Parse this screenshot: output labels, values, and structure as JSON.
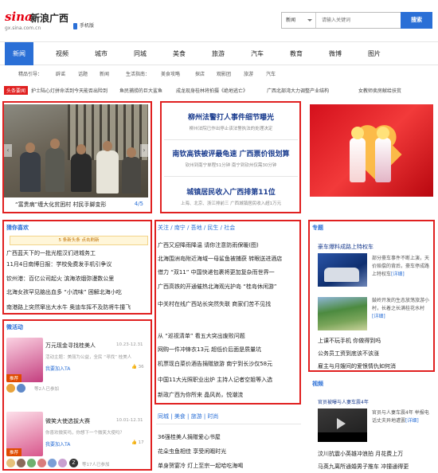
{
  "header": {
    "logo_mark": "sina",
    "logo_text": "新浪广西",
    "domain": "gx.sina.com.cn",
    "mobile": "手机版",
    "search_category": "新闻",
    "search_placeholder": "请输入关键词",
    "search_button": "搜索"
  },
  "nav": [
    "新闻",
    "视频",
    "城市",
    "同城",
    "美食",
    "旅游",
    "汽车",
    "教育",
    "微博",
    "图片"
  ],
  "subnav": {
    "label": "精品引导：",
    "items": [
      "辟谣",
      "话题",
      "新闻",
      "生活指南：",
      "美食攻略",
      "探店",
      "观影团",
      "旅游",
      "汽车"
    ]
  },
  "ticker": {
    "label": "头条要闻",
    "items": [
      "护士陆心灯拼命活到今天能否出险到",
      "鱼民捕捞的巨大鲨鱼",
      "成龙现身桂林将拍摄《绝地逃亡》",
      "广西北部湾大力调整产业结构",
      "女教师卖房献给扶贫"
    ]
  },
  "photo": {
    "caption": "“富贵病”缠大化贫困村 村民手脚变形",
    "pager": "4/5"
  },
  "headlines": [
    {
      "title": "柳州法警打人事件细节曝光",
      "sub": "柳州法院已作出停止该法警执法的处理决定"
    },
    {
      "title": "南钦高铁被评最龟速 广西票价很划算",
      "sub": "钦州到南宁单程51分钟 南宁到钦州仅需30分钟"
    },
    {
      "title": "城镇居民收入广西排第11位",
      "sub": "上海、北京、浙江排前三 广西城镇居民收入超1万元"
    }
  ],
  "guess": {
    "title": "猜你喜欢",
    "refresh": "5 条新头条 点击刷新",
    "items": [
      "广西蓝天下的一批光棍汉们进城务工",
      "11月4日南博日报：学校免费发手机引争议",
      "钦州港：百亿公司起火 滨海浓烟弥漫数公里",
      "北海女孩罕见脑出血多 “小流味” 困解北海小吃",
      "南港路上突然窜出大水牛 奥迪车挥不及防将牛撞飞"
    ]
  },
  "micro": {
    "title": "微活动",
    "cards": [
      {
        "name": "万元现金寻找桂美人",
        "date": "10.23-12.31",
        "desc": "活动主题：美丽为公益，全民 “寻找” 桂美人",
        "join": "我要加入TA",
        "count": "36",
        "joined": "等2人已参加"
      },
      {
        "name": "微笑大使选拔大赛",
        "date": "10.01-12.31",
        "desc": "你喜欢微笑吗，你想下一个微笑大使吗？",
        "join": "我要加入TA",
        "count": "17",
        "joined": "等17人已参加"
      }
    ]
  },
  "center_news": {
    "tabs": [
      "关注",
      "南宁",
      "吾地",
      "民生",
      "社会"
    ],
    "items": [
      "广西又迎降雨降温 请你注意防雨保暖(图)",
      "北海围洲岛附近海域一母鲨鱼被捕获 转眼送进酒店",
      "借力 “双11” 中国快递包裹将更加复杂而世界一",
      "广西高铁的开通催热北海观光护岛 “桂岛休闲游”",
      "中关村在线广西站长突然失联 商家们苦不见找",
      "从 “巡视清单” 看五大突出废败问题",
      "网购一件冲锋衣13元 超低价后面是质量坑",
      "机票现白菜价酒告捐赠旅游 南宁到长沙仅58元",
      "中国11大光照职业出炉 主持人记者空姐等入选",
      "新政广西为你所来 晶风尚，悦潮流"
    ],
    "tabs2": [
      "同城",
      "美食",
      "旅游",
      "时尚"
    ],
    "items2": [
      "36强桂美人捐赠爱心书屋",
      "花朵虫鱼相佳 享受闲暇时光",
      "单身贺宴冷 灯上至宗一起哈吃海喝"
    ]
  },
  "topics": {
    "title": "专题",
    "t1": {
      "title": "豪车爆料成路上特权车",
      "desc": "部分豪车事件不断上演，天价赔偿的背后，豪车停成路上特权车",
      "more": "[详细]"
    },
    "t2": {
      "desc": "鼓岭开发的生态放荡旅游小村，长着之长满桂花水村",
      "more": "[详细]"
    },
    "links": [
      "上课不玩手机 你做得到吗",
      "公务员工资到底该不该涨",
      "雇主与月嫂间的爱恨情仇如何消"
    ]
  },
  "video": {
    "title": "视频",
    "lead": "官员被曝与人妻车震4年",
    "desc": "官员与人妻车震4年 举报电话丈夫异地遭罢",
    "more": "[详细]",
    "items": [
      "汶川抗震小英雄冲浪拍 月花费上万",
      "马英九离所通婚男子推车 冲撞通得更"
    ]
  }
}
